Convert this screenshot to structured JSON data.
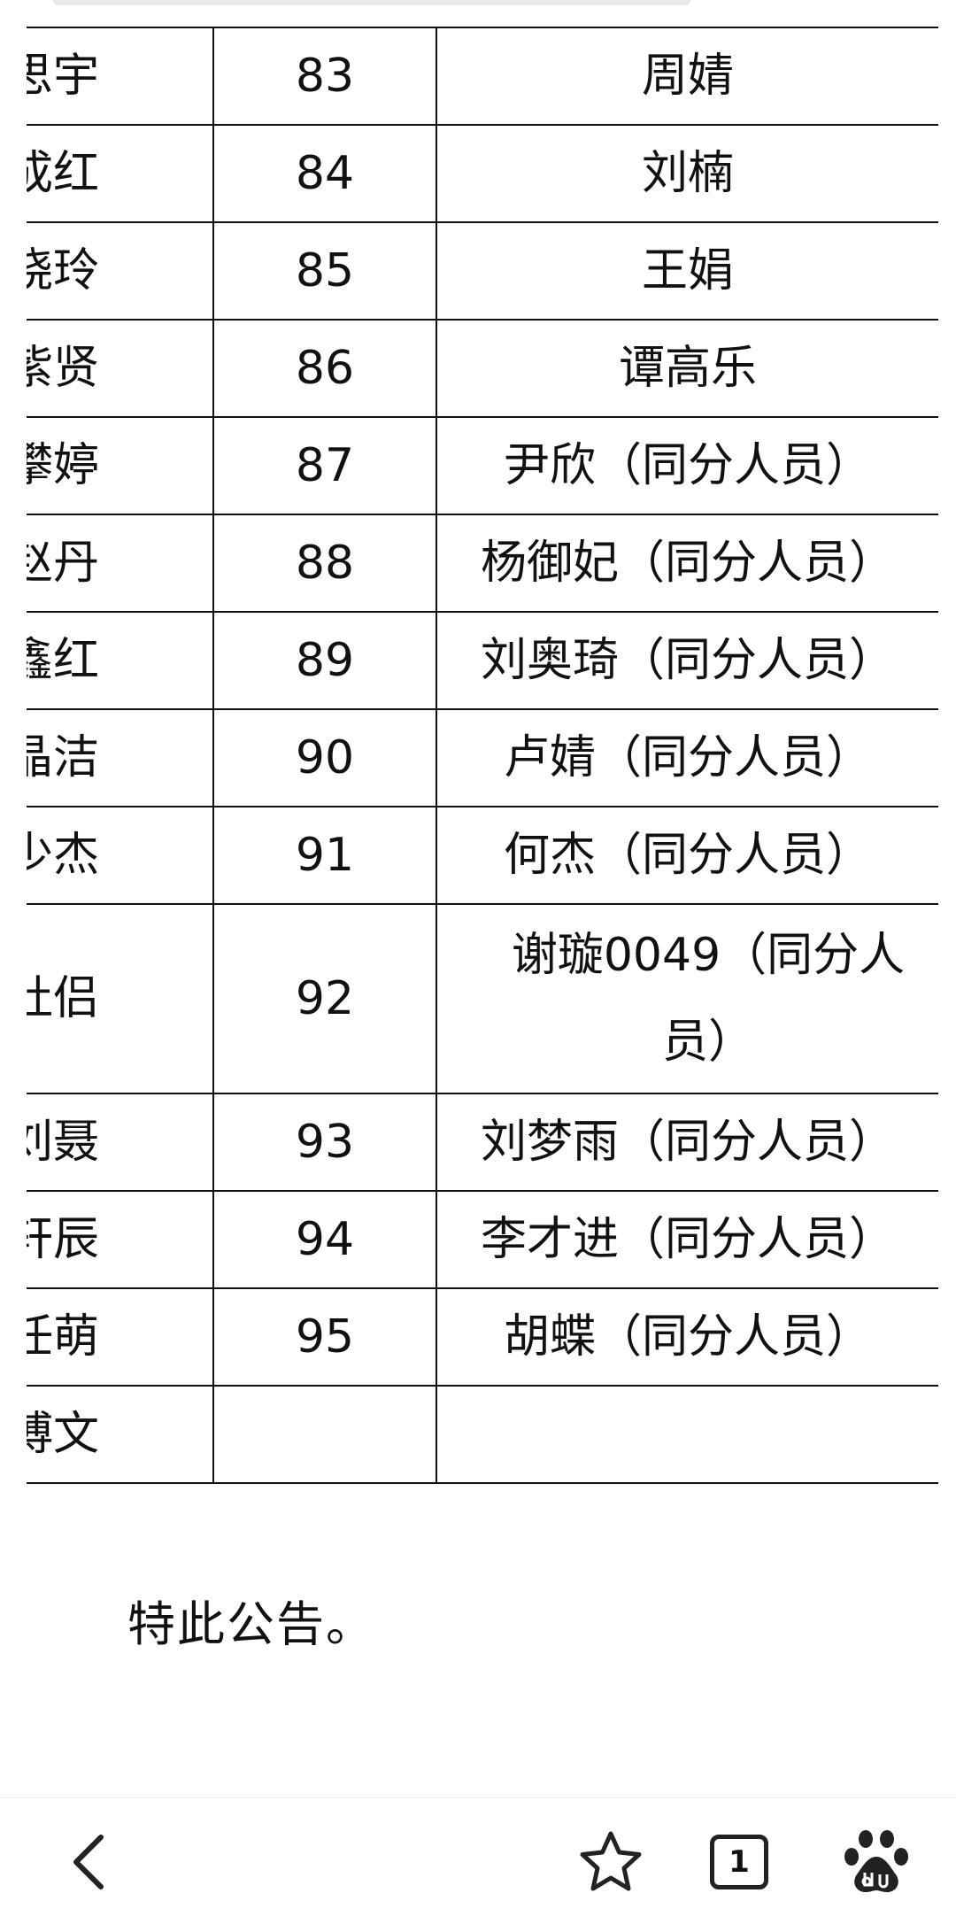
{
  "table": {
    "rows": [
      {
        "name": "思宇",
        "rank": "83",
        "person": "周婧"
      },
      {
        "name": "成红",
        "rank": "84",
        "person": "刘楠"
      },
      {
        "name": "晓玲",
        "rank": "85",
        "person": "王娟"
      },
      {
        "name": "紫贤",
        "rank": "86",
        "person": "谭高乐"
      },
      {
        "name": "攀婷",
        "rank": "87",
        "person": "尹欣（同分人员）"
      },
      {
        "name": "赵丹",
        "rank": "88",
        "person": "杨御妃（同分人员）"
      },
      {
        "name": "鑫红",
        "rank": "89",
        "person": "刘奥琦（同分人员）"
      },
      {
        "name": "晶洁",
        "rank": "90",
        "person": "卢婧（同分人员）"
      },
      {
        "name": "少杰",
        "rank": "91",
        "person": "何杰（同分人员）"
      },
      {
        "name": "杜侣",
        "rank": "92",
        "person": "谢璇0049（同分人员）"
      },
      {
        "name": "刘聂",
        "rank": "93",
        "person": "刘梦雨（同分人员）"
      },
      {
        "name": "轩辰",
        "rank": "94",
        "person": "李才进（同分人员）"
      },
      {
        "name": "任萌",
        "rank": "95",
        "person": "胡蝶（同分人员）"
      },
      {
        "name": "博文",
        "rank": "",
        "person": ""
      }
    ]
  },
  "notice": {
    "text": "特此公告。"
  },
  "bottom_bar": {
    "tab_count": "1",
    "icons": {
      "back": "chevron-left-icon",
      "favorite": "star-icon",
      "tabs": "tabs-icon",
      "home": "baidu-paw-icon"
    }
  },
  "colors": {
    "text": "#111111",
    "background": "#ffffff"
  }
}
